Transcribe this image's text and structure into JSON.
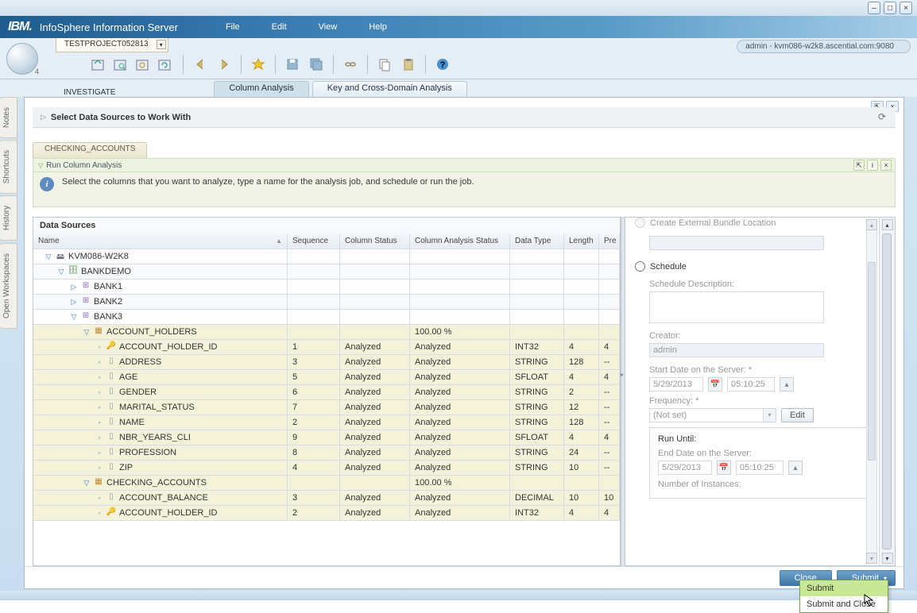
{
  "title": "InfoSphere Information Server",
  "menus": [
    "File",
    "Edit",
    "View",
    "Help"
  ],
  "window_controls": [
    "min",
    "max",
    "close"
  ],
  "project_tab": "TESTPROJECT052813",
  "user_pill": "admin - kvm086-w2k8.ascential.com:9080",
  "globe_badge": "4",
  "investigate_label": "INVESTIGATE",
  "ctx_tabs": [
    {
      "label": "Column Analysis",
      "active": true
    },
    {
      "label": "Key and Cross-Domain Analysis",
      "active": false
    }
  ],
  "side_tabs": [
    "Notes",
    "Shortcuts",
    "History",
    "Open Workspaces"
  ],
  "select_ds_label": "Select Data Sources to Work With",
  "acc_tab": "CHECKING_ACCOUNTS",
  "rca_label": "Run Column Analysis",
  "info_text": "Select the columns that you want to analyze, type a name for the analysis job, and schedule or run the job.",
  "ds_title": "Data Sources",
  "columns": {
    "name": "Name",
    "seq": "Sequence",
    "cstat": "Column Status",
    "astat": "Column Analysis Status",
    "dtype": "Data Type",
    "len": "Length",
    "pre": "Pre"
  },
  "rows": [
    {
      "level": 0,
      "exp": "open",
      "icon": "server",
      "name": "KVM086-W2K8",
      "sel": false
    },
    {
      "level": 1,
      "exp": "open",
      "icon": "db",
      "name": "BANKDEMO",
      "sel": false
    },
    {
      "level": 2,
      "exp": "closed",
      "icon": "schema",
      "name": "BANK1",
      "sel": false
    },
    {
      "level": 2,
      "exp": "closed",
      "icon": "schema",
      "name": "BANK2",
      "sel": false
    },
    {
      "level": 2,
      "exp": "open",
      "icon": "schema",
      "name": "BANK3",
      "sel": false
    },
    {
      "level": 3,
      "exp": "open",
      "icon": "tbl",
      "name": "ACCOUNT_HOLDERS",
      "astat": "100.00 %",
      "sel": true
    },
    {
      "level": 4,
      "exp": "leaf",
      "icon": "key",
      "name": "ACCOUNT_HOLDER_ID",
      "seq": "1",
      "cstat": "Analyzed",
      "astat": "Analyzed",
      "dtype": "INT32",
      "len": "4",
      "pre": "4",
      "sel": true
    },
    {
      "level": 4,
      "exp": "leaf",
      "icon": "col",
      "name": "ADDRESS",
      "seq": "3",
      "cstat": "Analyzed",
      "astat": "Analyzed",
      "dtype": "STRING",
      "len": "128",
      "pre": "--",
      "sel": true
    },
    {
      "level": 4,
      "exp": "leaf",
      "icon": "col",
      "name": "AGE",
      "seq": "5",
      "cstat": "Analyzed",
      "astat": "Analyzed",
      "dtype": "SFLOAT",
      "len": "4",
      "pre": "4",
      "sel": true
    },
    {
      "level": 4,
      "exp": "leaf",
      "icon": "col",
      "name": "GENDER",
      "seq": "6",
      "cstat": "Analyzed",
      "astat": "Analyzed",
      "dtype": "STRING",
      "len": "2",
      "pre": "--",
      "sel": true
    },
    {
      "level": 4,
      "exp": "leaf",
      "icon": "col",
      "name": "MARITAL_STATUS",
      "seq": "7",
      "cstat": "Analyzed",
      "astat": "Analyzed",
      "dtype": "STRING",
      "len": "12",
      "pre": "--",
      "sel": true
    },
    {
      "level": 4,
      "exp": "leaf",
      "icon": "col",
      "name": "NAME",
      "seq": "2",
      "cstat": "Analyzed",
      "astat": "Analyzed",
      "dtype": "STRING",
      "len": "128",
      "pre": "--",
      "sel": true
    },
    {
      "level": 4,
      "exp": "leaf",
      "icon": "col",
      "name": "NBR_YEARS_CLI",
      "seq": "9",
      "cstat": "Analyzed",
      "astat": "Analyzed",
      "dtype": "SFLOAT",
      "len": "4",
      "pre": "4",
      "sel": true
    },
    {
      "level": 4,
      "exp": "leaf",
      "icon": "col",
      "name": "PROFESSION",
      "seq": "8",
      "cstat": "Analyzed",
      "astat": "Analyzed",
      "dtype": "STRING",
      "len": "24",
      "pre": "--",
      "sel": true
    },
    {
      "level": 4,
      "exp": "leaf",
      "icon": "col",
      "name": "ZIP",
      "seq": "4",
      "cstat": "Analyzed",
      "astat": "Analyzed",
      "dtype": "STRING",
      "len": "10",
      "pre": "--",
      "sel": true
    },
    {
      "level": 3,
      "exp": "open",
      "icon": "tbl",
      "name": "CHECKING_ACCOUNTS",
      "astat": "100.00 %",
      "sel": true
    },
    {
      "level": 4,
      "exp": "leaf",
      "icon": "col",
      "name": "ACCOUNT_BALANCE",
      "seq": "3",
      "cstat": "Analyzed",
      "astat": "Analyzed",
      "dtype": "DECIMAL",
      "len": "10",
      "pre": "10",
      "sel": true
    },
    {
      "level": 4,
      "exp": "leaf",
      "icon": "key",
      "name": "ACCOUNT_HOLDER_ID",
      "seq": "2",
      "cstat": "Analyzed",
      "astat": "Analyzed",
      "dtype": "INT32",
      "len": "4",
      "pre": "4",
      "sel": true
    }
  ],
  "form": {
    "create_ext": "Create External Bundle Location",
    "schedule": "Schedule",
    "sched_desc_lbl": "Schedule Description:",
    "creator_lbl": "Creator:",
    "creator_val": "admin",
    "start_lbl": "Start Date on the Server:   *",
    "start_date": "5/29/2013",
    "start_time": "05:10:25",
    "freq_lbl": "Frequency:   *",
    "freq_val": "(Not set)",
    "edit_btn": "Edit",
    "run_until": "Run Until:",
    "end_lbl": "End Date on the Server:",
    "end_date": "5/29/2013",
    "end_time": "05:10:25",
    "num_inst": "Number of Instances:"
  },
  "buttons": {
    "close": "Close",
    "submit": "Submit"
  },
  "dd_menu": [
    "Submit",
    "Submit and Close"
  ]
}
